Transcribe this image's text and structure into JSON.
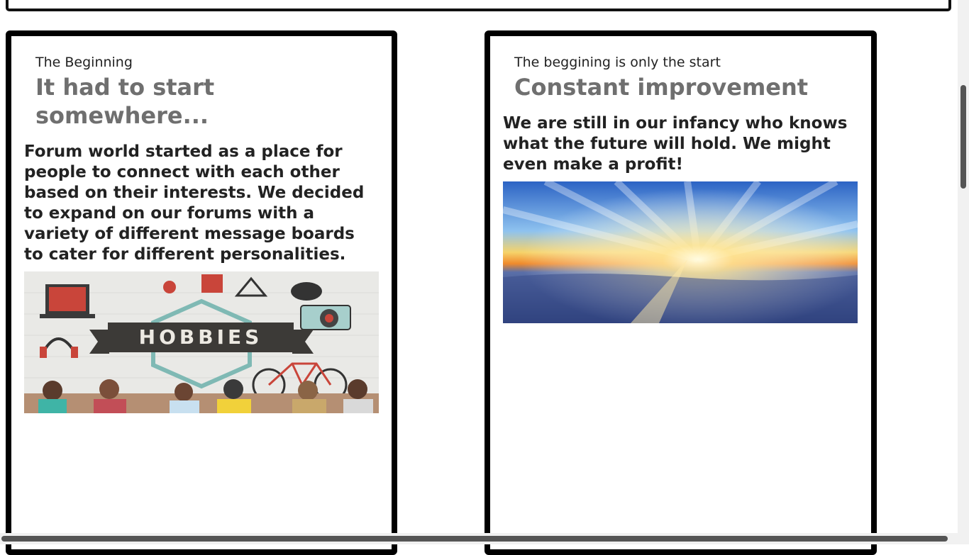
{
  "left_card": {
    "kicker": "The Beginning",
    "title": "It had to start somewhere...",
    "body": "Forum world started as a place for people to connect with each other based on their interests. We decided to expand on our forums with a variety of different message boards to cater for different personalities.",
    "image_text": "HOBBIES"
  },
  "right_card": {
    "kicker": "The beggining is only the start",
    "title": "Constant improvement",
    "body": "We are still in our infancy who knows what the future will hold. We might even make a profit!"
  }
}
